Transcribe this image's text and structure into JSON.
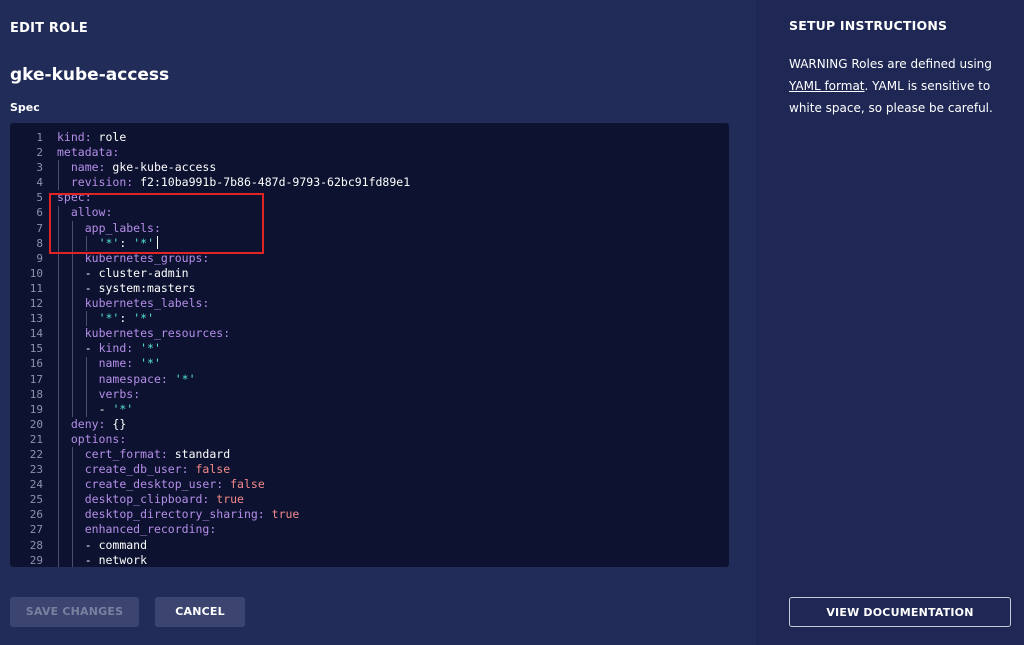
{
  "header": {
    "title": "EDIT ROLE"
  },
  "role": {
    "name": "gke-kube-access"
  },
  "spec": {
    "label": "Spec"
  },
  "editor": {
    "lines": [
      {
        "n": "1",
        "indent": 0,
        "parts": [
          [
            "key",
            "kind: "
          ],
          [
            "val",
            "role"
          ]
        ]
      },
      {
        "n": "2",
        "indent": 0,
        "parts": [
          [
            "key",
            "metadata:"
          ]
        ]
      },
      {
        "n": "3",
        "indent": 1,
        "parts": [
          [
            "key",
            "name: "
          ],
          [
            "val",
            "gke-kube-access"
          ]
        ]
      },
      {
        "n": "4",
        "indent": 1,
        "parts": [
          [
            "key",
            "revision: "
          ],
          [
            "val",
            "f2:10ba991b-7b86-487d-9793-62bc91fd89e1"
          ]
        ]
      },
      {
        "n": "5",
        "indent": 0,
        "parts": [
          [
            "key",
            "spec:"
          ]
        ]
      },
      {
        "n": "6",
        "indent": 1,
        "parts": [
          [
            "key",
            "allow:"
          ]
        ]
      },
      {
        "n": "7",
        "indent": 2,
        "parts": [
          [
            "key",
            "app_labels:"
          ]
        ]
      },
      {
        "n": "8",
        "indent": 3,
        "parts": [
          [
            "str",
            "'*'"
          ],
          [
            "val",
            ": "
          ],
          [
            "str",
            "'*'"
          ]
        ],
        "cursor": true
      },
      {
        "n": "9",
        "indent": 2,
        "parts": [
          [
            "key",
            "kubernetes_groups:"
          ]
        ]
      },
      {
        "n": "10",
        "indent": 2,
        "parts": [
          [
            "val",
            "- cluster-admin"
          ]
        ]
      },
      {
        "n": "11",
        "indent": 2,
        "parts": [
          [
            "val",
            "- system:masters"
          ]
        ]
      },
      {
        "n": "12",
        "indent": 2,
        "parts": [
          [
            "key",
            "kubernetes_labels:"
          ]
        ]
      },
      {
        "n": "13",
        "indent": 3,
        "parts": [
          [
            "str",
            "'*'"
          ],
          [
            "val",
            ": "
          ],
          [
            "str",
            "'*'"
          ]
        ]
      },
      {
        "n": "14",
        "indent": 2,
        "parts": [
          [
            "key",
            "kubernetes_resources:"
          ]
        ]
      },
      {
        "n": "15",
        "indent": 2,
        "parts": [
          [
            "val",
            "- "
          ],
          [
            "key",
            "kind: "
          ],
          [
            "str",
            "'*'"
          ]
        ]
      },
      {
        "n": "16",
        "indent": 3,
        "parts": [
          [
            "key",
            "name: "
          ],
          [
            "str",
            "'*'"
          ]
        ]
      },
      {
        "n": "17",
        "indent": 3,
        "parts": [
          [
            "key",
            "namespace: "
          ],
          [
            "str",
            "'*'"
          ]
        ]
      },
      {
        "n": "18",
        "indent": 3,
        "parts": [
          [
            "key",
            "verbs:"
          ]
        ]
      },
      {
        "n": "19",
        "indent": 3,
        "parts": [
          [
            "val",
            "- "
          ],
          [
            "str",
            "'*'"
          ]
        ]
      },
      {
        "n": "20",
        "indent": 1,
        "parts": [
          [
            "key",
            "deny: "
          ],
          [
            "val",
            "{}"
          ]
        ]
      },
      {
        "n": "21",
        "indent": 1,
        "parts": [
          [
            "key",
            "options:"
          ]
        ]
      },
      {
        "n": "22",
        "indent": 2,
        "parts": [
          [
            "key",
            "cert_format: "
          ],
          [
            "val",
            "standard"
          ]
        ]
      },
      {
        "n": "23",
        "indent": 2,
        "parts": [
          [
            "key",
            "create_db_user: "
          ],
          [
            "bool",
            "false"
          ]
        ]
      },
      {
        "n": "24",
        "indent": 2,
        "parts": [
          [
            "key",
            "create_desktop_user: "
          ],
          [
            "bool",
            "false"
          ]
        ]
      },
      {
        "n": "25",
        "indent": 2,
        "parts": [
          [
            "key",
            "desktop_clipboard: "
          ],
          [
            "bool",
            "true"
          ]
        ]
      },
      {
        "n": "26",
        "indent": 2,
        "parts": [
          [
            "key",
            "desktop_directory_sharing: "
          ],
          [
            "bool",
            "true"
          ]
        ]
      },
      {
        "n": "27",
        "indent": 2,
        "parts": [
          [
            "key",
            "enhanced_recording:"
          ]
        ]
      },
      {
        "n": "28",
        "indent": 2,
        "parts": [
          [
            "val",
            "- command"
          ]
        ]
      },
      {
        "n": "29",
        "indent": 2,
        "parts": [
          [
            "val",
            "- network"
          ]
        ]
      }
    ]
  },
  "buttons": {
    "save_label": "SAVE CHANGES",
    "cancel_label": "CANCEL",
    "docs_label": "VIEW DOCUMENTATION"
  },
  "instructions": {
    "title": "SETUP INSTRUCTIONS",
    "text_before": "WARNING Roles are defined using ",
    "link": "YAML format",
    "text_after": ". YAML is sensitive to white space, so please be careful."
  },
  "colors": {
    "background": "#222c59",
    "editor_bg": "#0c1230",
    "key": "#b58ee8",
    "string": "#55e6d2",
    "bool": "#f48a8a",
    "highlight": "#e02323"
  }
}
